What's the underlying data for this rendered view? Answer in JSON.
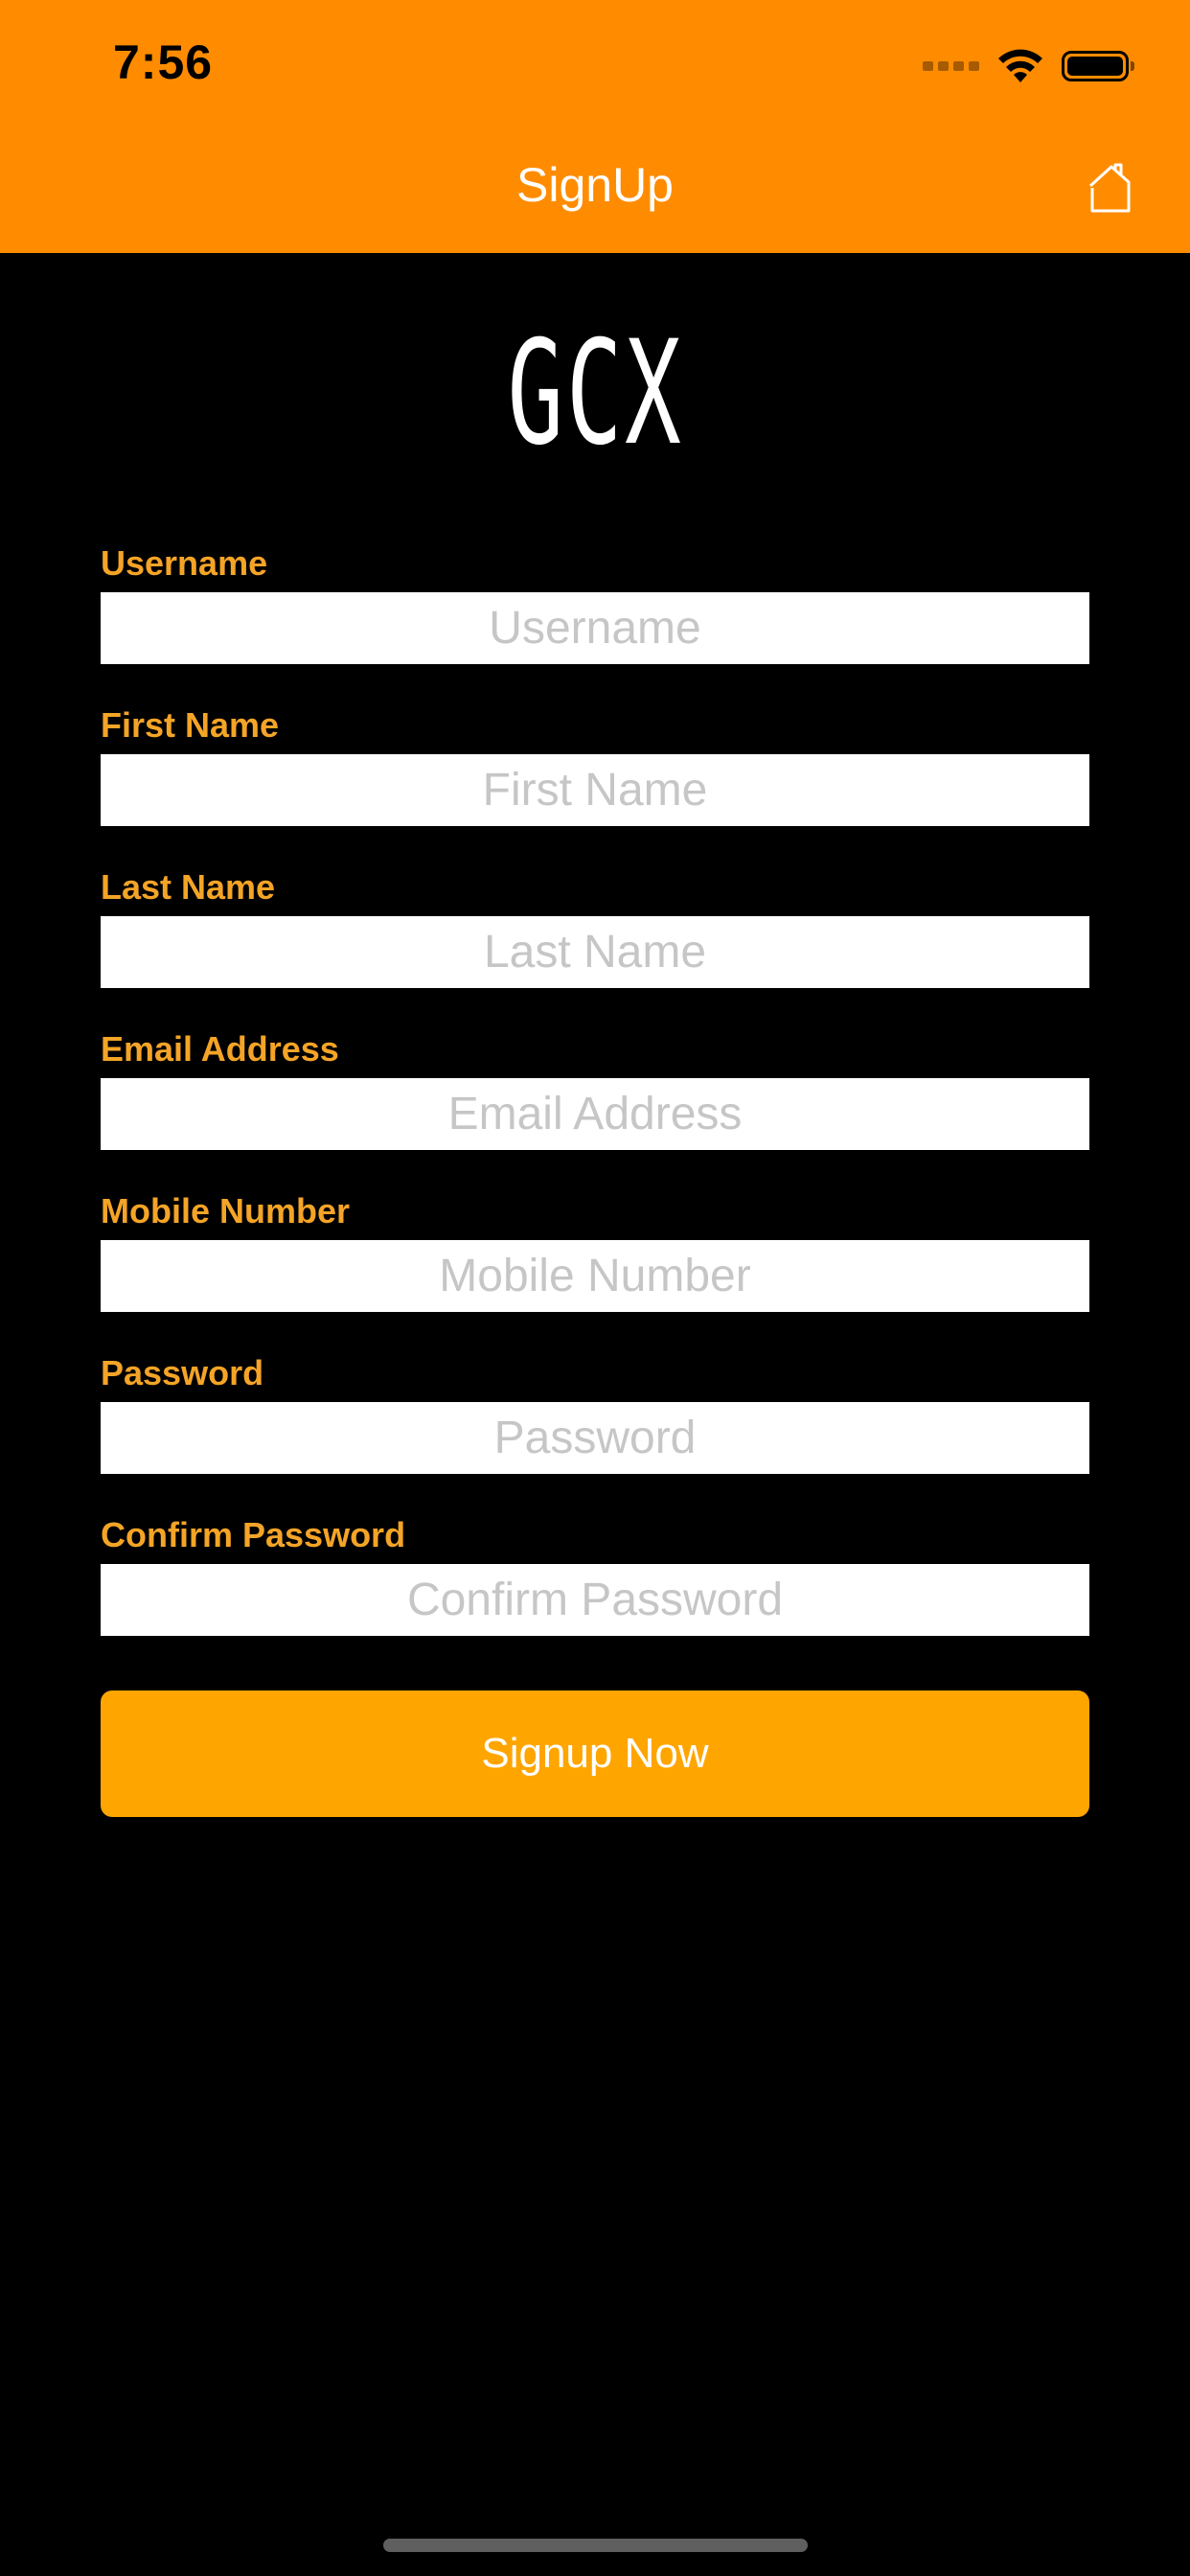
{
  "status_bar": {
    "time": "7:56",
    "icons": [
      "signal-icon",
      "wifi-icon",
      "battery-icon"
    ]
  },
  "nav": {
    "title": "SignUp",
    "right_icon": "home-icon"
  },
  "logo": {
    "text": "GCX"
  },
  "fields": [
    {
      "label": "Username",
      "placeholder": "Username"
    },
    {
      "label": "First Name",
      "placeholder": "First Name"
    },
    {
      "label": "Last Name",
      "placeholder": "Last Name"
    },
    {
      "label": "Email Address",
      "placeholder": "Email Address"
    },
    {
      "label": "Mobile Number",
      "placeholder": "Mobile Number"
    },
    {
      "label": "Password",
      "placeholder": "Password"
    },
    {
      "label": "Confirm Password",
      "placeholder": "Confirm Password"
    }
  ],
  "submit": {
    "label": "Signup Now"
  },
  "colors": {
    "header": "#FF8C00",
    "label": "#F4A426",
    "button": "#FFA500",
    "background": "#000000"
  }
}
